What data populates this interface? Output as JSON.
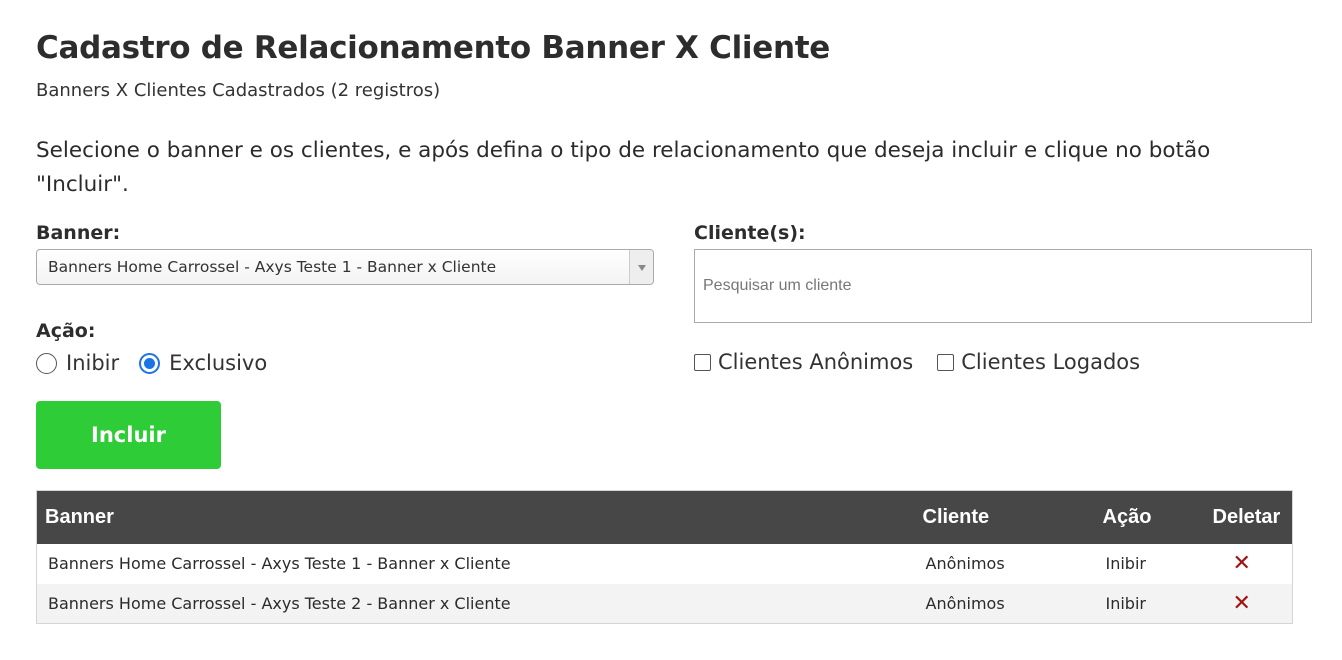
{
  "header": {
    "title": "Cadastro de Relacionamento Banner X Cliente",
    "subtitle": "Banners X Clientes Cadastrados (2 registros)"
  },
  "instructions": "Selecione o banner e os clientes, e após defina o tipo de relacionamento que deseja incluir e clique no botão \"Incluir\".",
  "form": {
    "banner_label": "Banner:",
    "banner_selected": "Banners Home Carrossel - Axys Teste 1 - Banner x Cliente",
    "clientes_label": "Cliente(s):",
    "clientes_placeholder": "Pesquisar um cliente",
    "acao_label": "Ação:",
    "acao_options": [
      {
        "label": "Inibir",
        "checked": false
      },
      {
        "label": "Exclusivo",
        "checked": true
      }
    ],
    "cliente_filters": [
      {
        "label": "Clientes Anônimos",
        "checked": false
      },
      {
        "label": "Clientes Logados",
        "checked": false
      }
    ],
    "incluir_label": "Incluir"
  },
  "table": {
    "headers": [
      "Banner",
      "Cliente",
      "Ação",
      "Deletar"
    ],
    "rows": [
      {
        "banner": "Banners Home Carrossel - Axys Teste 1 - Banner x Cliente",
        "cliente": "Anônimos",
        "acao": "Inibir",
        "delete_icon": "close-icon"
      },
      {
        "banner": "Banners Home Carrossel - Axys Teste 2 - Banner x Cliente",
        "cliente": "Anônimos",
        "acao": "Inibir",
        "delete_icon": "close-icon"
      }
    ]
  },
  "colors": {
    "incluir_button": "#2ecc37",
    "table_header": "#474747",
    "delete_icon": "#a11212",
    "radio_checked": "#1a73e8"
  }
}
